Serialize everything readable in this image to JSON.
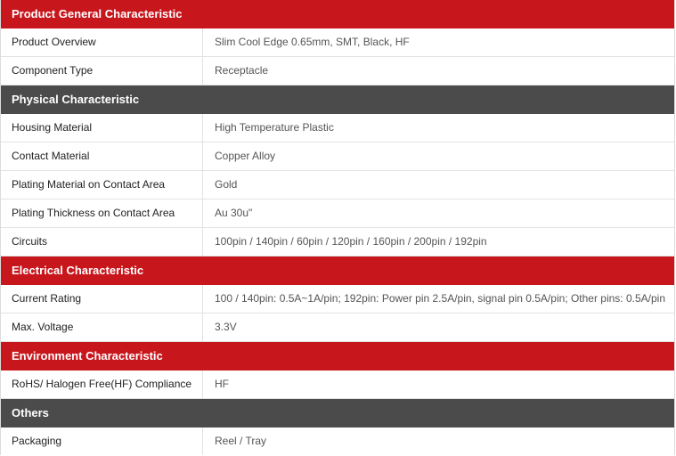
{
  "sections": [
    {
      "title": "Product General Characteristic",
      "rows": [
        {
          "label": "Product Overview",
          "value": "Slim Cool Edge 0.65mm, SMT, Black, HF"
        },
        {
          "label": "Component Type",
          "value": "Receptacle"
        }
      ]
    },
    {
      "title": "Physical Characteristic",
      "rows": [
        {
          "label": "Housing Material",
          "value": "High Temperature Plastic"
        },
        {
          "label": "Contact Material",
          "value": "Copper Alloy"
        },
        {
          "label": "Plating Material on Contact Area",
          "value": "Gold"
        },
        {
          "label": "Plating Thickness on Contact Area",
          "value": "Au 30u\""
        },
        {
          "label": "Circuits",
          "value": "100pin / 140pin / 60pin / 120pin / 160pin / 200pin / 192pin"
        }
      ]
    },
    {
      "title": "Electrical Characteristic",
      "rows": [
        {
          "label": "Current Rating",
          "value": "100 / 140pin: 0.5A~1A/pin; 192pin: Power pin 2.5A/pin, signal pin 0.5A/pin; Other pins: 0.5A/pin"
        },
        {
          "label": "Max. Voltage",
          "value": "3.3V"
        }
      ]
    },
    {
      "title": "Environment Characteristic",
      "rows": [
        {
          "label": "RoHS/ Halogen Free(HF) Compliance",
          "value": "HF"
        }
      ]
    },
    {
      "title": "Others",
      "rows": [
        {
          "label": "Packaging",
          "value": "Reel / Tray"
        }
      ]
    }
  ],
  "colors": {
    "red_header": "#c8161d",
    "gray_header": "#4b4b4b"
  }
}
